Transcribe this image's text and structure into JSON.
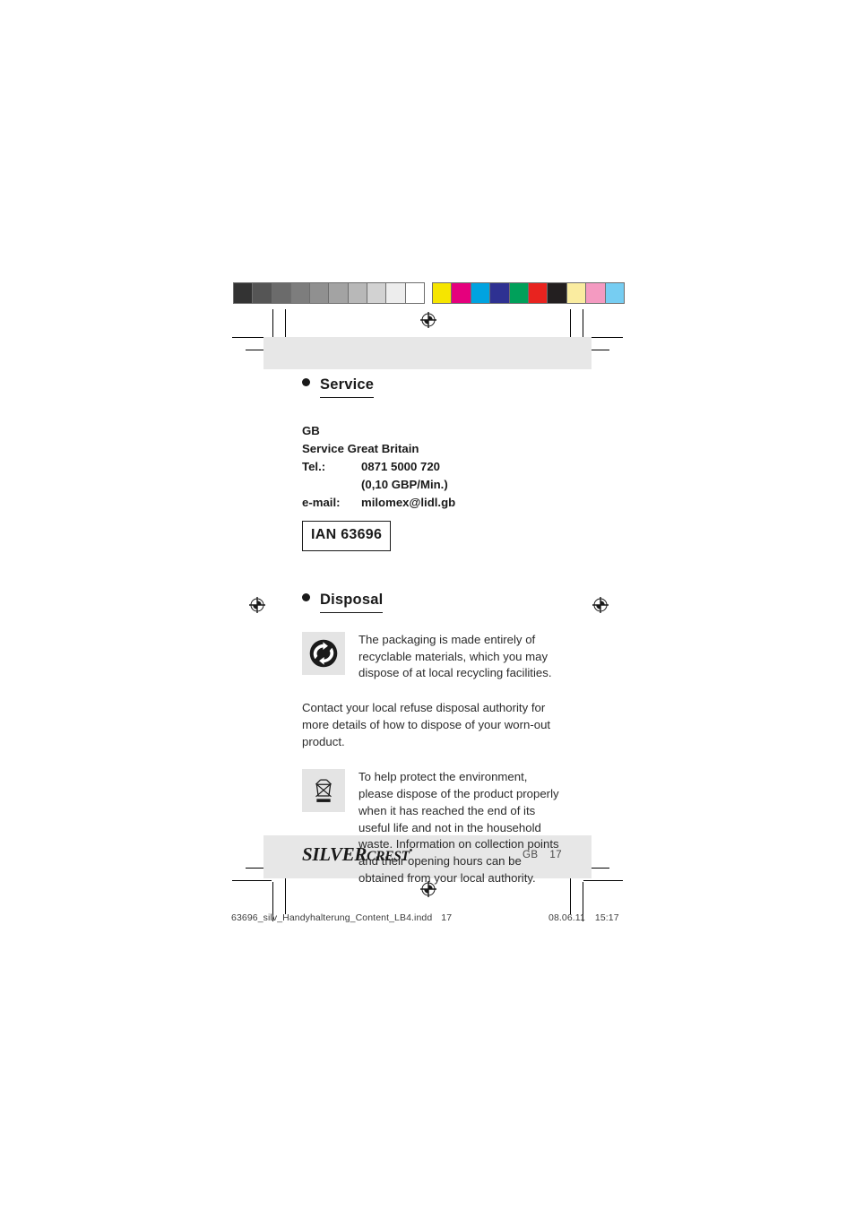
{
  "document": {
    "type": "print-proof-page",
    "language_code": "GB",
    "page_number": "17"
  },
  "calibration": {
    "grayscale_label": "grayscale-step-wedge",
    "grayscale_swatches": [
      "#333333",
      "#555555",
      "#6b6b6b",
      "#7d7d7d",
      "#909090",
      "#a3a3a3",
      "#b8b8b8",
      "#d2d2d2",
      "#ededed",
      "#ffffff"
    ],
    "color_label": "process-color-patches",
    "color_swatches": [
      "#f6e500",
      "#e5007d",
      "#00a3e0",
      "#2e3192",
      "#00a05a",
      "#e8231f",
      "#231f20",
      "#faeca0",
      "#f49ac1",
      "#76cdf2"
    ]
  },
  "service": {
    "heading": "Service",
    "country_code": "GB",
    "country_name": "Service Great Britain",
    "tel_label": "Tel.:",
    "tel_value": "0871 5000 720",
    "tel_rate": "(0,10 GBP/Min.)",
    "email_label": "e-mail:",
    "email_value": "milomex@lidl.gb",
    "ian": "IAN 63696"
  },
  "disposal": {
    "heading": "Disposal",
    "recycling_icon_name": "green-dot-recycling-icon",
    "packaging_text": "The packaging is made entirely of recyclable materials, which you may dispose of at local recycling facilities.",
    "authority_text": "Contact your local refuse disposal authority for more details of how to dispose of your worn-out product.",
    "weee_icon_name": "crossed-out-wheelie-bin-icon",
    "weee_text": "To help protect the environment, please dispose of the product properly when it has reached the end of its useful life and not in the household waste. Information on collection points and their opening hours can be obtained from your local authority."
  },
  "footer": {
    "brand_upper": "SILVER",
    "brand_lower": "CREST",
    "brand_mark": "•",
    "locale": "GB",
    "page": "17"
  },
  "slug": {
    "filename": "63696_silv_Handyhalterung_Content_LB4.indd",
    "page": "17",
    "date": "08.06.11",
    "time": "15:17"
  }
}
